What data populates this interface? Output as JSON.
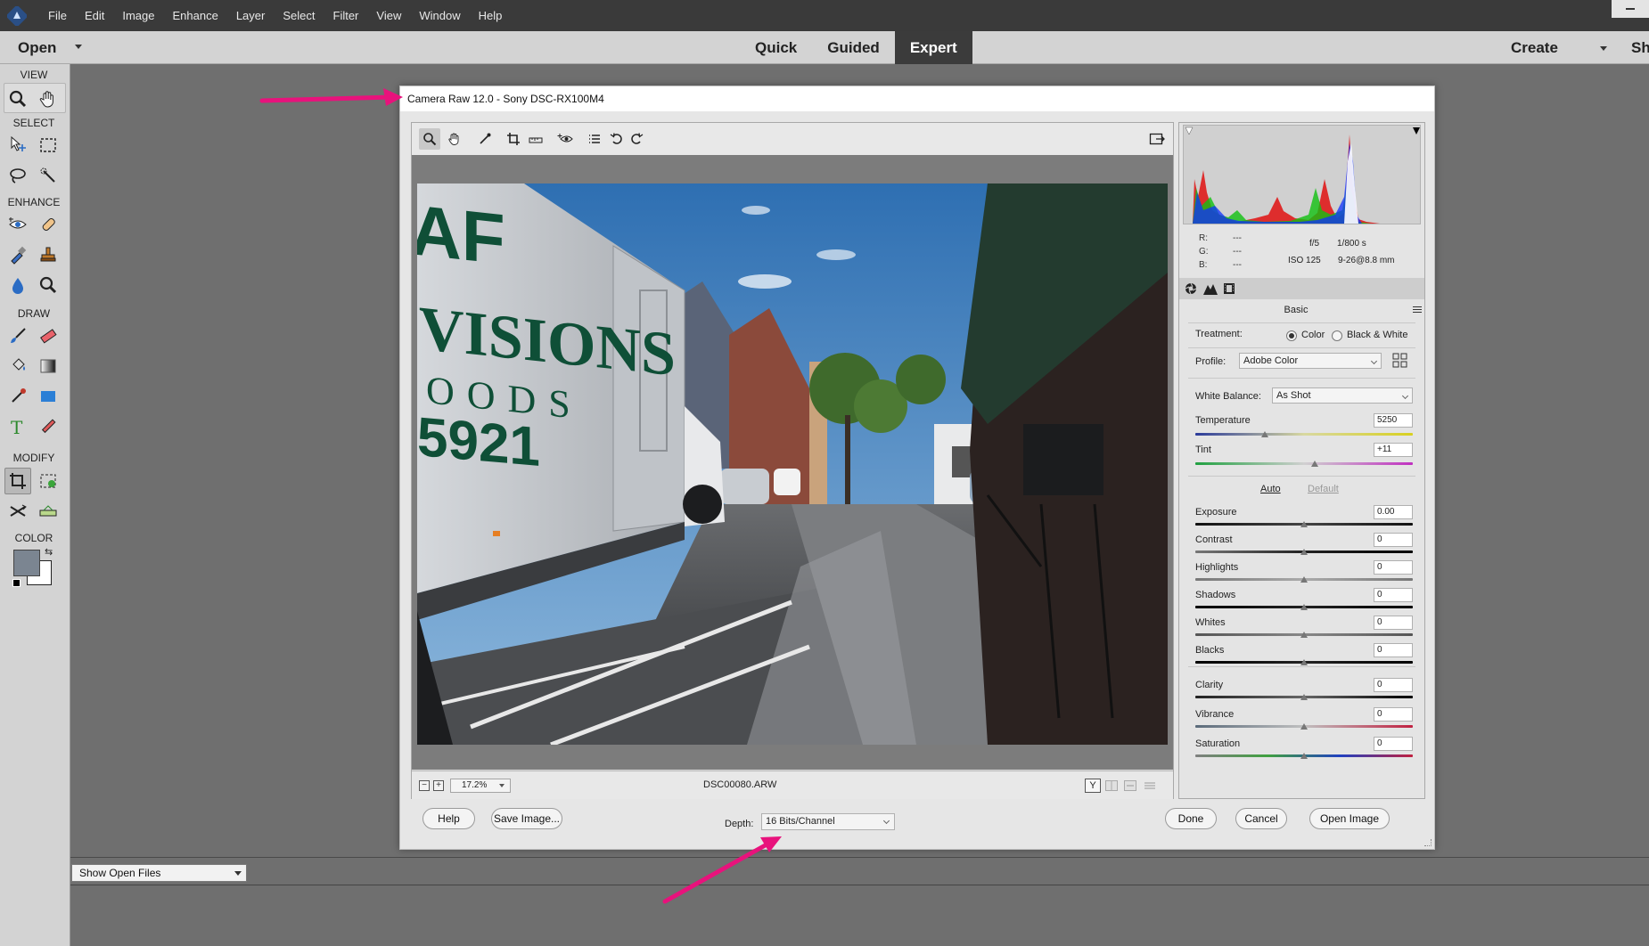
{
  "app": {
    "menu": [
      "File",
      "Edit",
      "Image",
      "Enhance",
      "Layer",
      "Select",
      "Filter",
      "View",
      "Window",
      "Help"
    ],
    "icons": {
      "logo": "elements-logo-icon",
      "minimize": "minimize-icon"
    }
  },
  "modebar": {
    "open_label": "Open",
    "tabs": [
      "Quick",
      "Guided",
      "Expert"
    ],
    "active_tab": "Expert",
    "create_label": "Create",
    "share_label": "Sh"
  },
  "toolpanel": {
    "sections": [
      "VIEW",
      "SELECT",
      "ENHANCE",
      "DRAW",
      "MODIFY",
      "COLOR"
    ],
    "tools": {
      "view": [
        "zoom-tool-icon",
        "hand-tool-icon"
      ],
      "select": [
        "move-tool-icon",
        "marquee-tool-icon",
        "lasso-tool-icon",
        "quick-selection-tool-icon"
      ],
      "enhance": [
        "red-eye-tool-icon",
        "spot-healing-tool-icon",
        "smart-brush-tool-icon",
        "clone-stamp-tool-icon",
        "blur-tool-icon",
        "sponge-tool-icon"
      ],
      "draw": [
        "brush-tool-icon",
        "eraser-tool-icon",
        "paint-bucket-tool-icon",
        "gradient-tool-icon",
        "eyedropper-tool-icon",
        "shape-tool-icon",
        "type-tool-icon",
        "pencil-tool-icon"
      ],
      "modify": [
        "crop-tool-icon",
        "recompose-tool-icon",
        "content-aware-move-tool-icon",
        "straighten-tool-icon"
      ]
    },
    "foreground_color": "#7b8591",
    "background_color": "#ffffff"
  },
  "workspace": {
    "bin_selector": "Show Open Files"
  },
  "dialog": {
    "title": "Camera Raw 12.0  -  Sony DSC-RX100M4",
    "toolbar_icons": [
      "zoom-icon",
      "hand-icon",
      "white-balance-icon",
      "crop-icon",
      "straighten-icon",
      "red-eye-icon",
      "list-icon",
      "rotate-left-icon",
      "rotate-right-icon",
      "fullscreen-icon"
    ],
    "zoom_level": "17.2%",
    "filename": "DSC00080.ARW",
    "view_buttons": [
      "Y",
      "before-after-icon",
      "swap-icon",
      "settings-icon"
    ],
    "readout": {
      "r_label": "R:",
      "r_value": "---",
      "g_label": "G:",
      "g_value": "---",
      "b_label": "B:",
      "b_value": "---",
      "aperture": "f/5",
      "shutter": "1/800 s",
      "iso": "ISO 125",
      "lens": "9-26@8.8 mm"
    },
    "panel_tabs": [
      "basic-panel-icon",
      "tone-curve-icon",
      "camera-calibration-icon"
    ],
    "panel_name": "Basic",
    "treatment": {
      "label": "Treatment:",
      "options": [
        "Color",
        "Black & White"
      ],
      "selected": "Color"
    },
    "profile": {
      "label": "Profile:",
      "value": "Adobe Color"
    },
    "white_balance": {
      "label": "White Balance:",
      "value": "As Shot"
    },
    "temperature": {
      "label": "Temperature",
      "value": "5250",
      "level": 0.32
    },
    "tint": {
      "label": "Tint",
      "value": "+11",
      "level": 0.55
    },
    "auto_label": "Auto",
    "default_label": "Default",
    "sliders": [
      {
        "label": "Exposure",
        "value": "0.00",
        "level": 0.5
      },
      {
        "label": "Contrast",
        "value": "0",
        "level": 0.5
      },
      {
        "label": "Highlights",
        "value": "0",
        "level": 0.5
      },
      {
        "label": "Shadows",
        "value": "0",
        "level": 0.5
      },
      {
        "label": "Whites",
        "value": "0",
        "level": 0.5
      },
      {
        "label": "Blacks",
        "value": "0",
        "level": 0.5
      }
    ],
    "presence": [
      {
        "label": "Clarity",
        "value": "0",
        "level": 0.5
      },
      {
        "label": "Vibrance",
        "value": "0",
        "level": 0.5
      },
      {
        "label": "Saturation",
        "value": "0",
        "level": 0.5
      }
    ],
    "buttons": {
      "help": "Help",
      "save": "Save Image...",
      "done": "Done",
      "cancel": "Cancel",
      "open": "Open Image"
    },
    "depth": {
      "label": "Depth:",
      "value": "16 Bits/Channel"
    }
  },
  "photo_text": {
    "line1": "AF",
    "line2": "VISIONS",
    "line3": "OODS",
    "line4": "5921"
  },
  "annotation_color": "#e8127c"
}
